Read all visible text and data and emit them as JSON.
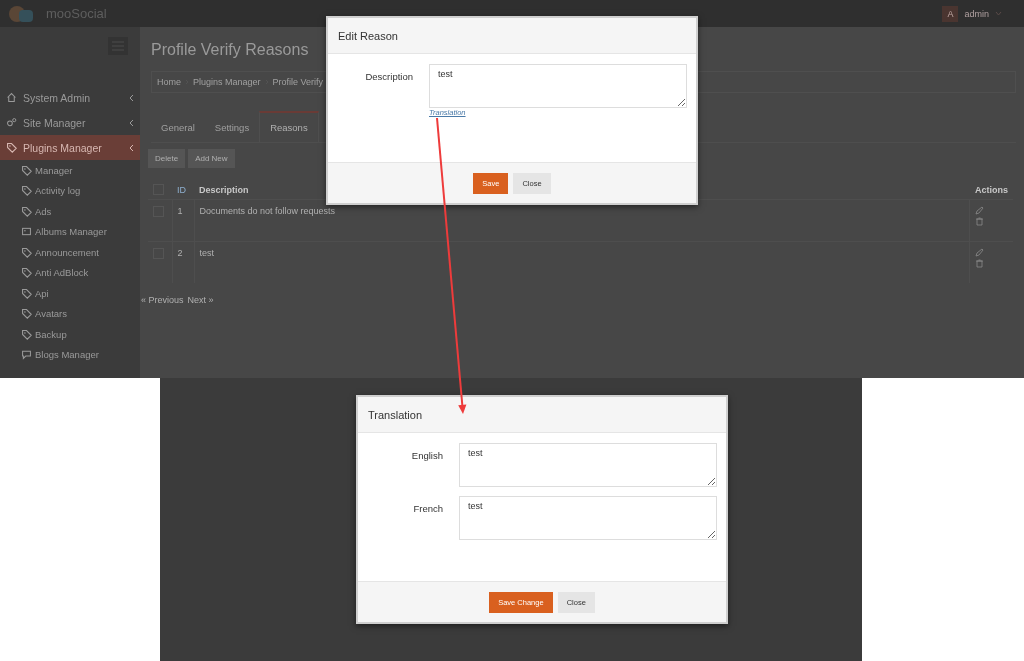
{
  "header": {
    "logo_text": "mooSocial",
    "user_initial": "A",
    "user_name": "admin"
  },
  "sidebar": {
    "items": [
      {
        "label": "System Admin",
        "kind": "home",
        "selected": false
      },
      {
        "label": "Site Manager",
        "kind": "gears",
        "selected": false
      },
      {
        "label": "Plugins Manager",
        "kind": "tag",
        "selected": true,
        "children": [
          {
            "label": "Manager",
            "kind": "tag"
          },
          {
            "label": "Activity log",
            "kind": "tag"
          },
          {
            "label": "Ads",
            "kind": "tag"
          },
          {
            "label": "Albums Manager",
            "kind": "photo"
          },
          {
            "label": "Announcement",
            "kind": "tag"
          },
          {
            "label": "Anti AdBlock",
            "kind": "tag"
          },
          {
            "label": "Api",
            "kind": "tag"
          },
          {
            "label": "Avatars",
            "kind": "tag"
          },
          {
            "label": "Backup",
            "kind": "tag"
          },
          {
            "label": "Blogs Manager",
            "kind": "comment"
          }
        ]
      }
    ]
  },
  "page": {
    "title": "Profile Verify Reasons",
    "breadcrumb": [
      "Home",
      "Plugins Manager",
      "Profile Verify"
    ],
    "tabs": [
      {
        "label": "General",
        "selected": false
      },
      {
        "label": "Settings",
        "selected": false
      },
      {
        "label": "Reasons",
        "selected": true
      }
    ],
    "buttons": [
      "Delete",
      "Add New"
    ],
    "table": {
      "select_all": {
        "checked": false
      },
      "columns": [
        "ID",
        "Description",
        "Actions"
      ],
      "rows": [
        {
          "checked": false,
          "id": "1",
          "description": "Documents do not follow requests"
        },
        {
          "checked": false,
          "id": "2",
          "description": "test"
        }
      ]
    },
    "pager": [
      "« Previous",
      "Next »"
    ]
  },
  "edit_modal": {
    "title": "Edit Reason",
    "field_label": "Description",
    "value": "test",
    "link": "Translation",
    "buttons": [
      "Save",
      "Close"
    ]
  },
  "translation_modal": {
    "title": "Translation",
    "fields": [
      {
        "label": "English",
        "value": "test"
      },
      {
        "label": "French",
        "value": "test"
      }
    ],
    "buttons": [
      "Save Change",
      "Close"
    ]
  }
}
